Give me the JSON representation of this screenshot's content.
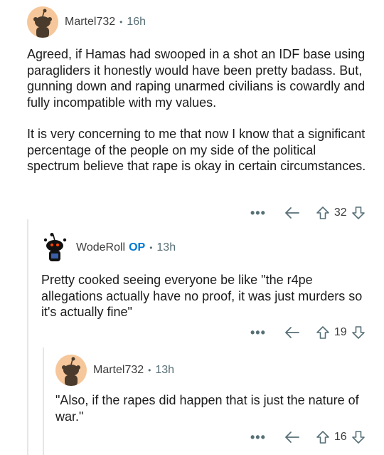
{
  "comments": [
    {
      "username": "Martel732",
      "op_badge": "",
      "age": "16h",
      "paragraphs": [
        "Agreed, if Hamas had swooped in a shot an IDF base using paragliders it honestly would have been pretty badass. But, gunning down and raping unarmed civilians is cowardly and fully incompatible with my values.",
        "It is very concerning to me that now I know that a significant percentage of the people on my side of the political spectrum believe that rape is okay in certain circumstances."
      ],
      "votes": "32",
      "more_label": "•••"
    },
    {
      "username": "WodeRoll",
      "op_badge": "OP",
      "age": "13h",
      "paragraphs": [
        "Pretty cooked seeing everyone be like \"the r4pe allegations actually have no proof, it was just murders so it's actually fine\""
      ],
      "votes": "19",
      "more_label": "•••"
    },
    {
      "username": "Martel732",
      "op_badge": "",
      "age": "13h",
      "paragraphs": [
        "\"Also, if the rapes did happen that is just the nature of war.\""
      ],
      "votes": "16",
      "more_label": "•••"
    }
  ],
  "separator": "•",
  "colors": {
    "op": "#0079d3",
    "avatar_bg": "#f6c79a",
    "thread_line": "#e6e6e6"
  },
  "icons": [
    "snoo-avatar-icon",
    "more-icon",
    "reply-icon",
    "upvote-icon",
    "downvote-icon"
  ]
}
